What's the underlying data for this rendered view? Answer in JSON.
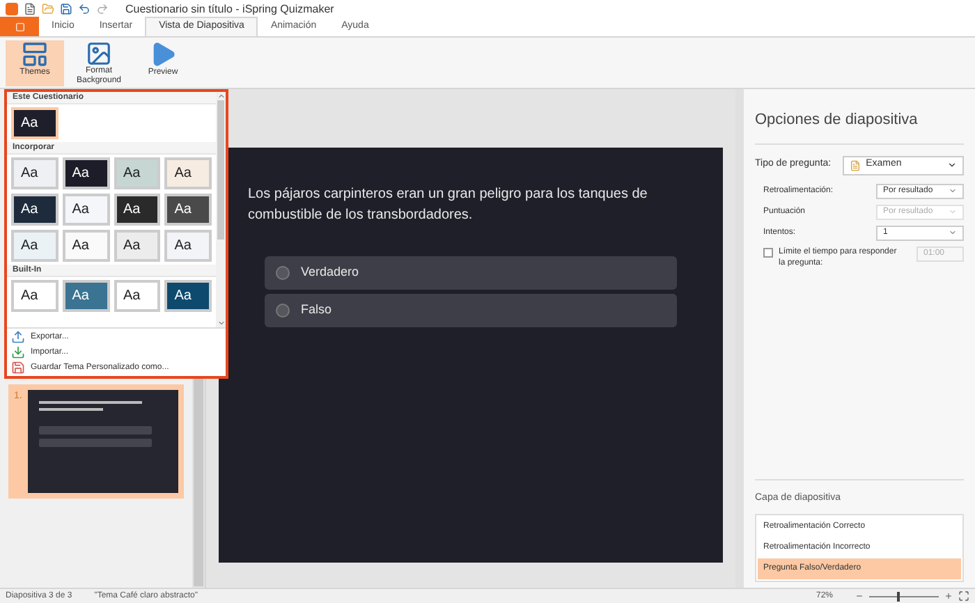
{
  "window": {
    "title": "Cuestionario sin título - iSpring Quizmaker"
  },
  "tabs": [
    {
      "label": "Inicio",
      "selected": false
    },
    {
      "label": "Insertar",
      "selected": false
    },
    {
      "label": "Vista de Diapositiva",
      "selected": true
    },
    {
      "label": "Animación",
      "selected": false
    },
    {
      "label": "Ayuda",
      "selected": false
    }
  ],
  "ribbon": [
    {
      "label": "Themes",
      "kind": "themes",
      "selected": true
    },
    {
      "label": "Format Background",
      "kind": "background",
      "selected": false
    },
    {
      "label": "Preview",
      "kind": "preview",
      "selected": false
    }
  ],
  "themes_menu": {
    "sections": [
      {
        "title": "Este Cuestionario",
        "themes": [
          {
            "label": "Aa",
            "color": "#1e1f2b",
            "selected": true
          }
        ]
      },
      {
        "title": "Incorporar",
        "themes": [
          {
            "label": "Aa",
            "color": "#eef0f4",
            "selected": false
          },
          {
            "label": "Aa",
            "color": "#1c1d28",
            "selected": false
          },
          {
            "label": "Aa",
            "color": "#c6d6d2",
            "selected": false
          },
          {
            "label": "Aa",
            "color": "#f6ece2",
            "selected": false
          },
          {
            "label": "Aa",
            "color": "#1d2b3d",
            "selected": false
          },
          {
            "label": "Aa",
            "color": "#f4f6f9",
            "selected": false
          },
          {
            "label": "Aa",
            "color": "#2a2a2a",
            "selected": false
          },
          {
            "label": "Aa",
            "color": "#4a4a4a",
            "selected": false
          },
          {
            "label": "Aa",
            "color": "#eaf2f6",
            "selected": false
          },
          {
            "label": "Aa",
            "color": "#fafafa",
            "selected": false
          },
          {
            "label": "Aa",
            "color": "#ececec",
            "selected": false
          },
          {
            "label": "Aa",
            "color": "#f2f4f8",
            "selected": false
          }
        ]
      },
      {
        "title": "Built-In",
        "themes": [
          {
            "label": "Aa",
            "color": "#ffffff",
            "selected": false
          },
          {
            "label": "Aa",
            "color": "#3b7392",
            "selected": false
          },
          {
            "label": "Aa",
            "color": "#ffffff",
            "selected": false
          },
          {
            "label": "Aa",
            "color": "#0d4a6e",
            "selected": false
          }
        ]
      }
    ],
    "actions": [
      {
        "label": "Exportar...",
        "kind": "export"
      },
      {
        "label": "Importar...",
        "kind": "import"
      },
      {
        "label": "Guardar Tema Personalizado como...",
        "kind": "save"
      }
    ]
  },
  "slides": [
    {
      "number": "1.",
      "selected": true
    }
  ],
  "slide": {
    "question": "Los pájaros carpinteros eran un gran peligro para los tanques de combustible de los transbordadores.",
    "answers": [
      "Verdadero",
      "Falso"
    ]
  },
  "options": {
    "title": "Opciones de diapositiva",
    "type_label": "Tipo de pregunta:",
    "type_value": "Examen",
    "fields": [
      {
        "label": "Retroalimentación:",
        "value": "Por resultado",
        "disabled": false
      },
      {
        "label": "Puntuación",
        "value": "Por resultado",
        "disabled": true
      },
      {
        "label": "Intentos:",
        "value": "1",
        "disabled": false
      }
    ],
    "time_limit": {
      "label": "Límite el tiempo para responder la pregunta:",
      "checked": false,
      "value": "01:00"
    }
  },
  "layers": {
    "title": "Capa de diapositiva",
    "items": [
      {
        "label": "Retroalimentación Correcto",
        "selected": false
      },
      {
        "label": "Retroalimentación Incorrecto",
        "selected": false
      },
      {
        "label": "Pregunta Falso/Verdadero",
        "selected": true
      }
    ]
  },
  "status_bar": {
    "slide": "Diapositiva 3 de 3",
    "theme": "\"Tema Café claro abstracto\"",
    "zoom": "72%",
    "level": 0.4
  }
}
